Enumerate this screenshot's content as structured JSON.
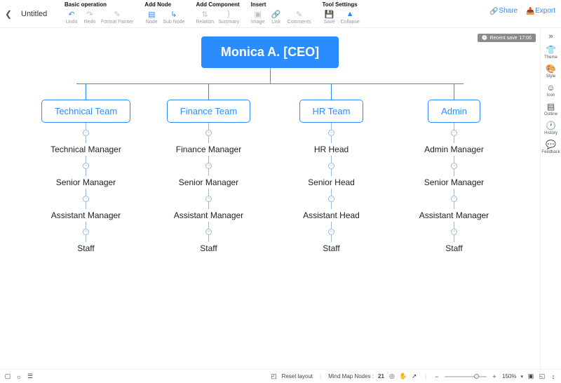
{
  "header": {
    "title": "Untitled",
    "groups": {
      "basic": {
        "label": "Basic operation",
        "undo": "Undo",
        "redo": "Redo",
        "fpaint": "Format Painter"
      },
      "addnode": {
        "label": "Add Node",
        "node": "Node",
        "subnode": "Sub Node"
      },
      "addcomp": {
        "label": "Add Component",
        "relation": "Relation",
        "summary": "Summary"
      },
      "insert": {
        "label": "Insert",
        "image": "Image",
        "link": "Link",
        "comments": "Comments"
      },
      "tools": {
        "label": "Tool Settings",
        "save": "Save",
        "collapse": "Collapse"
      }
    },
    "share": "Share",
    "export": "Export"
  },
  "sidebar": {
    "theme": "Theme",
    "style": "Style",
    "icon": "Icon",
    "outline": "Outline",
    "history": "History",
    "feedback": "Feedback"
  },
  "save_badge": {
    "prefix": "Recent save",
    "time": "17:06"
  },
  "org": {
    "root": "Monica A. [CEO]",
    "branches": [
      "Technical Team",
      "Finance Team",
      "HR Team",
      "Admin"
    ],
    "chains": {
      "tech": [
        "Technical Manager",
        "Senior Manager",
        "Assistant Manager",
        "Staff"
      ],
      "finance": [
        "Finance Manager",
        "Senior Manager",
        "Assistant Manager",
        "Staff"
      ],
      "hr": [
        "HR Head",
        "Senior Head",
        "Assistant Head",
        "Staff"
      ],
      "admin": [
        "Admin Manager",
        "Senior Manager",
        "Assistant Manager",
        "Staff"
      ]
    }
  },
  "bottom": {
    "reset": "Reset layout",
    "nodes_label": "Mind Map Nodes :",
    "nodes_count": "21",
    "zoom_pct": "150%"
  }
}
